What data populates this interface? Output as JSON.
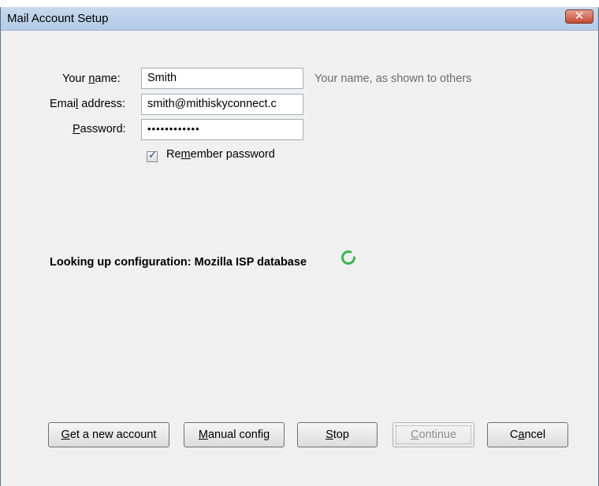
{
  "window": {
    "title": "Mail Account Setup",
    "close_glyph": "✕"
  },
  "form": {
    "name_label_pre": "Your ",
    "name_label_ul": "n",
    "name_label_post": "ame:",
    "name_value": "Smith",
    "name_hint": "Your name, as shown to others",
    "email_label_pre": "Emai",
    "email_label_ul": "l",
    "email_label_post": " address:",
    "email_value": "smith@mithiskyconnect.c",
    "password_label_ul": "P",
    "password_label_post": "assword:",
    "password_value": "••••••••••••",
    "remember_label_pre": "Re",
    "remember_label_ul": "m",
    "remember_label_post": "ember password",
    "remember_checked": true,
    "check_glyph": "✓"
  },
  "status": {
    "text": "Looking up configuration: Mozilla ISP database",
    "spinner_color": "#3fb34f"
  },
  "buttons": {
    "get_account_ul": "G",
    "get_account_post": "et a new account",
    "manual_config_ul": "M",
    "manual_config_post": "anual config",
    "stop_ul": "S",
    "stop_post": "top",
    "continue_ul": "C",
    "continue_post": "ontinue",
    "continue_enabled": false,
    "cancel_pre": "C",
    "cancel_ul": "a",
    "cancel_post": "ncel"
  }
}
